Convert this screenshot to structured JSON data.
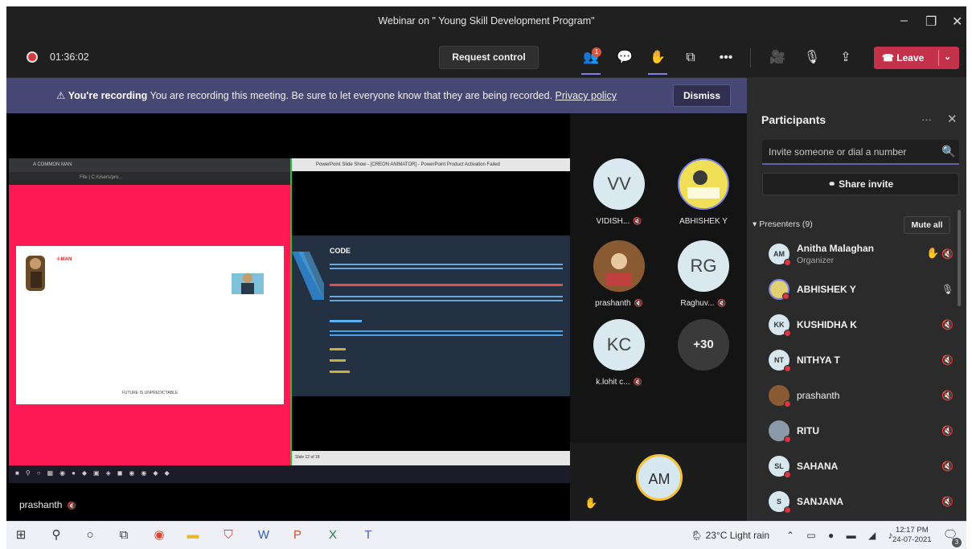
{
  "window": {
    "title": "Webinar on \" Young Skill Development Program\""
  },
  "toolbar": {
    "timer": "01:36:02",
    "request_control": "Request control",
    "participants_badge": "1",
    "leave_label": "Leave"
  },
  "banner": {
    "bold": "You're recording",
    "message": " You are recording this meeting. Be sure to let everyone know that they are being recorded. ",
    "link": "Privacy policy",
    "dismiss": "Dismiss"
  },
  "stage": {
    "presenter_label": "prashanth",
    "browser_tab": "A COMMON MAN",
    "browser_address": "File | C:/Users/pro...",
    "page_heading": "-I-MAN",
    "page_footer": "FUTURE IS UNPREDICTABLE",
    "ppt_titlebar": "PowerPoint Slide Show - [CREON ANIMATOR] - PowerPoint Product Activation Failed",
    "slide_title": "CODE",
    "slide_status": "Slide 12 of 18"
  },
  "gallery": {
    "tiles": [
      {
        "initials": "VV",
        "name": "VIDISH..."
      },
      {
        "initials": "",
        "name": "ABHISHEK Y"
      },
      {
        "initials": "",
        "name": "prashanth"
      },
      {
        "initials": "RG",
        "name": "Raghuv..."
      },
      {
        "initials": "KC",
        "name": "k.lohit c..."
      },
      {
        "initials": "+30",
        "name": ""
      }
    ],
    "self_initials": "AM"
  },
  "panel": {
    "title": "Participants",
    "invite_placeholder": "Invite someone or dial a number",
    "share_invite": "Share invite",
    "presenters_label": "Presenters (9)",
    "mute_all": "Mute all",
    "people": [
      {
        "initials": "AM",
        "name": "Anitha Malaghan",
        "role": "Organizer"
      },
      {
        "initials": "",
        "name": "ABHISHEK Y"
      },
      {
        "initials": "KK",
        "name": "KUSHIDHA K"
      },
      {
        "initials": "NT",
        "name": "NITHYA T"
      },
      {
        "initials": "",
        "name": "prashanth"
      },
      {
        "initials": "",
        "name": "RITU"
      },
      {
        "initials": "SL",
        "name": "SAHANA"
      },
      {
        "initials": "S",
        "name": "SANJANA"
      }
    ]
  },
  "taskbar": {
    "weather": "23°C  Light rain",
    "time": "12:17 PM",
    "date": "24-07-2021",
    "notif": "3"
  }
}
